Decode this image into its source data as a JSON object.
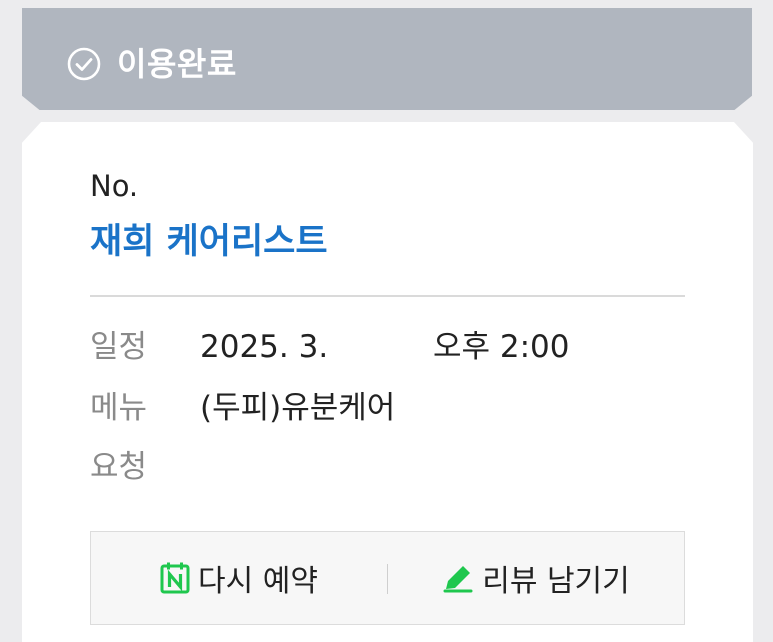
{
  "status": {
    "title": "이용완료",
    "icon": "check-circle-icon"
  },
  "booking": {
    "number_label": "No.",
    "shop_name": "재희 케어리스트",
    "schedule": {
      "label": "일정",
      "date": "2025. 3.",
      "time": "오후 2:00"
    },
    "menu": {
      "label": "메뉴",
      "value": "(두피)유분케어"
    },
    "request": {
      "label": "요청",
      "value": ""
    }
  },
  "actions": {
    "rebook": {
      "label": "다시 예약",
      "icon": "naver-calendar-icon",
      "icon_color": "#1fc74e"
    },
    "review": {
      "label": "리뷰 남기기",
      "icon": "pencil-icon",
      "icon_color": "#1fc74e"
    }
  },
  "colors": {
    "header_bg": "#b0b6bf",
    "shop_name": "#1a73c8",
    "accent_green": "#1fc74e"
  }
}
